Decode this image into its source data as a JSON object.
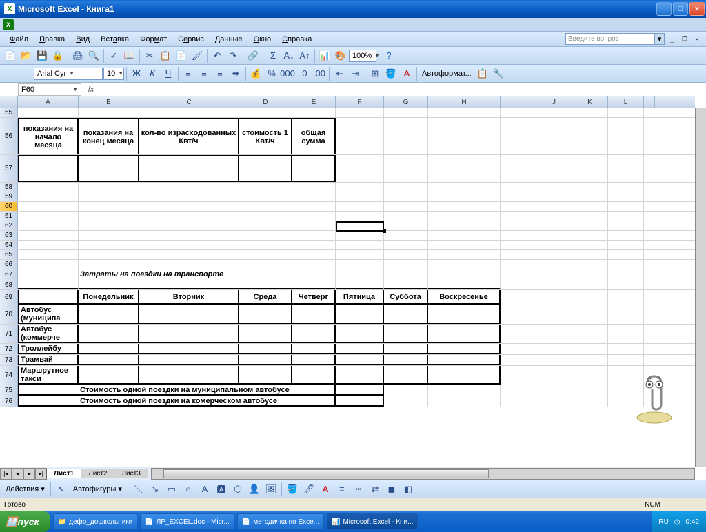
{
  "window": {
    "title": "Microsoft Excel - Книга1"
  },
  "menu": {
    "file": "Файл",
    "edit": "Правка",
    "view": "Вид",
    "insert": "Вставка",
    "format": "Формат",
    "service": "Сервис",
    "data": "Данные",
    "window": "Окно",
    "help": "Справка"
  },
  "askbox": {
    "placeholder": "Введите вопрос"
  },
  "font": {
    "name": "Arial Cyr",
    "size": "10",
    "zoom": "100%"
  },
  "autoformat_label": "Автоформат...",
  "namebox": "F60",
  "colheads": [
    "A",
    "B",
    "C",
    "D",
    "E",
    "F",
    "G",
    "H",
    "I",
    "J",
    "K",
    "L"
  ],
  "rows_first": "55",
  "table1": {
    "h1": "показания на начало месяца",
    "h2": "показания на конец месяца",
    "h3": "кол-во израсходованных Квт/ч",
    "h4": "стоимость 1 Квт/ч",
    "h5": "общая сумма"
  },
  "section_title": "Затраты на поездки на транспорте",
  "table2": {
    "days": {
      "mon": "Понедельник",
      "tue": "Вторник",
      "wed": "Среда",
      "thu": "Четверг",
      "fri": "Пятница",
      "sat": "Суббота",
      "sun": "Воскресенье"
    },
    "rows": {
      "bus_m": "Автобус (муниципа",
      "bus_k": "Автобус (коммерче",
      "troll": "Троллейбу",
      "tram": "Трамвай",
      "taxi": "Маршрутное такси"
    },
    "footer1": "Стоимость одной поездки на муниципальном автобусе",
    "footer2": "Стоимость одной поездки на комерческом автобусе"
  },
  "sheets": {
    "s1": "Лист1",
    "s2": "Лист2",
    "s3": "Лист3"
  },
  "drawbar": {
    "actions": "Действия",
    "autoshapes": "Автофигуры"
  },
  "status": {
    "ready": "Готово",
    "num": "NUM"
  },
  "taskbar": {
    "start": "пуск",
    "t1": "дефо_дошкольники",
    "t2": "ЛР_EXCEL.doc - Micr...",
    "t3": "методичка по Exce...",
    "t4": "Microsoft Excel - Кни...",
    "lang": "RU",
    "time": "0:42"
  }
}
